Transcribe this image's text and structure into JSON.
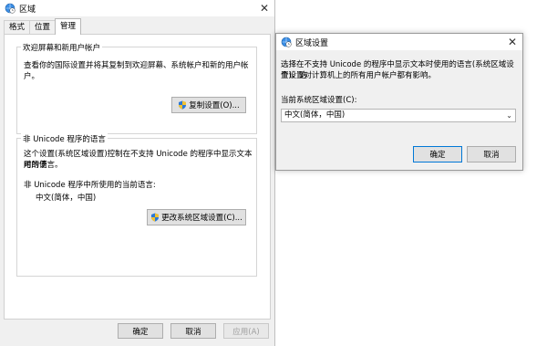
{
  "main_dialog": {
    "title": "区域",
    "close_glyph": "✕",
    "tabs": [
      {
        "label": "格式"
      },
      {
        "label": "位置"
      },
      {
        "label": "管理"
      }
    ],
    "welcome_group": {
      "legend": "欢迎屏幕和新用户帐户",
      "description": "查看你的国际设置并将其复制到欢迎屏幕、系统帐户和新的用户帐户。",
      "copy_button": "复制设置(O)..."
    },
    "unicode_group": {
      "legend": "非 Unicode 程序的语言",
      "description_line1": "这个设置(系统区域设置)控制在不支持 Unicode 的程序中显示文本时所使",
      "description_line2": "用的语言。",
      "current_label": "非 Unicode 程序中所使用的当前语言:",
      "current_value": "中文(简体，中国)",
      "change_button": "更改系统区域设置(C)..."
    },
    "ok_button": "确定",
    "cancel_button": "取消",
    "apply_button": "应用(A)"
  },
  "region_dialog": {
    "title": "区域设置",
    "close_glyph": "✕",
    "description_line1": "选择在不支持 Unicode 的程序中显示文本时使用的语言(系统区域设置)。这",
    "description_line2": "个设置对计算机上的所有用户帐户都有影响。",
    "select_label": "当前系统区域设置(C):",
    "select_value": "中文(简体，中国)",
    "ok_button": "确定",
    "cancel_button": "取消"
  },
  "colors": {
    "window_bg": "#f0f0f0",
    "button_bg": "#e1e1e1",
    "default_button_border": "#0078d7"
  }
}
